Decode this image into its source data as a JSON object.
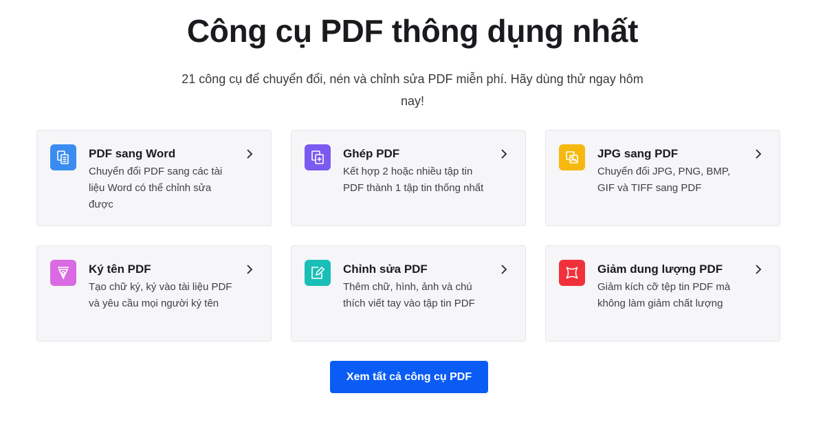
{
  "header": {
    "title": "Công cụ PDF thông dụng nhất",
    "subtitle": "21 công cụ để chuyển đổi, nén và chỉnh sửa PDF miễn phí. Hãy dùng thử ngay hôm nay!"
  },
  "tools": [
    {
      "title": "PDF sang Word",
      "description": "Chuyển đổi PDF sang các tài liệu Word có thể chỉnh sửa được",
      "icon": "pdf-to-word-icon",
      "color": "#3b8cf0"
    },
    {
      "title": "Ghép PDF",
      "description": "Kết hợp 2 hoặc nhiều tập tin PDF thành 1 tập tin thống nhất",
      "icon": "merge-pdf-icon",
      "color": "#7a5af0"
    },
    {
      "title": "JPG sang PDF",
      "description": "Chuyển đổi JPG, PNG, BMP, GIF và TIFF sang PDF",
      "icon": "jpg-to-pdf-icon",
      "color": "#f6b80e"
    },
    {
      "title": "Ký tên PDF",
      "description": "Tạo chữ ký, ký vào tài liệu PDF và yêu cầu mọi người ký tên",
      "icon": "sign-pdf-icon",
      "color": "#d96ae3"
    },
    {
      "title": "Chỉnh sửa PDF",
      "description": "Thêm chữ, hình, ảnh và chú thích viết tay vào tập tin PDF",
      "icon": "edit-pdf-icon",
      "color": "#19bfb6"
    },
    {
      "title": "Giảm dung lượng PDF",
      "description": "Giảm kích cỡ tệp tin PDF mà không làm giảm chất lượng",
      "icon": "compress-pdf-icon",
      "color": "#f0313b"
    }
  ],
  "cta": {
    "label": "Xem tất cả công cụ PDF",
    "color": "#0a5cf5"
  }
}
